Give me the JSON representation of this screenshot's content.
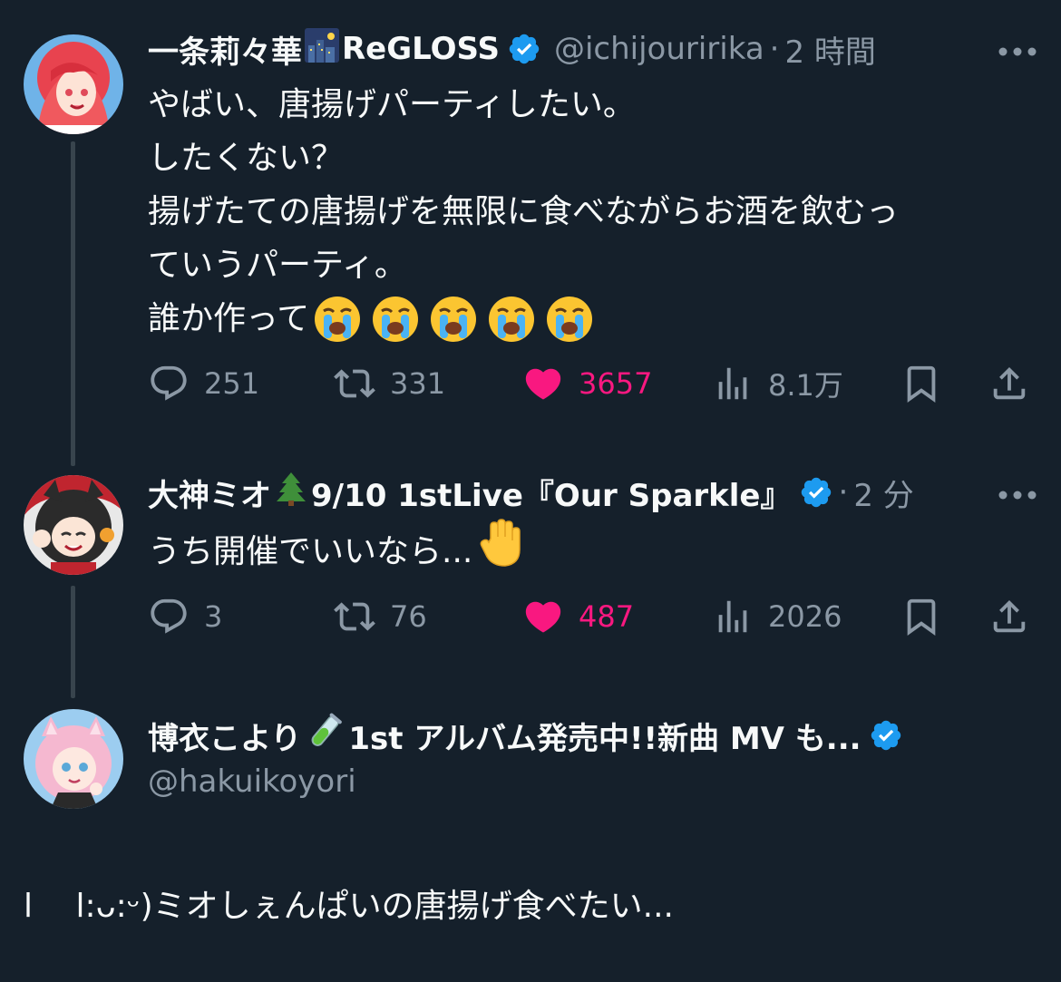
{
  "tweets": [
    {
      "name": "一条莉々華",
      "name_suffix": "ReGLOSS",
      "handle": "@ichijouririka",
      "time": "2 時間",
      "lines": [
        "やばい、唐揚げパーティしたい。",
        "したくない？",
        "揚げたての唐揚げを無限に食べながらお酒を飲むっ",
        "ていうパーティ。",
        "誰か作って"
      ],
      "trailing_emoji": [
        "crying-face",
        "crying-face",
        "crying-face",
        "crying-face",
        "crying-face"
      ],
      "replies": "251",
      "retweets": "331",
      "likes": "3657",
      "views": "8.1万"
    },
    {
      "name": "大神ミオ",
      "name_suffix": "9/10 1stLive『Our Sparkle』",
      "time": "2 分",
      "text": "うち開催でいいなら...",
      "trailing_emoji": [
        "raised-hand"
      ],
      "replies": "3",
      "retweets": "76",
      "likes": "487",
      "views": "2026"
    },
    {
      "name": "博衣こより",
      "name_suffix": "1st アルバム発売中!!新曲 MV も...",
      "handle": "@hakuikoyori",
      "text": "l　 l:ᴗ:ᵕ)ミオしぇんぱいの唐揚げ食べたい..."
    }
  ],
  "colors": {
    "background": "#15202b",
    "text": "#f7f9f9",
    "secondary": "#8b98a5",
    "like": "#f91880",
    "verified": "#1d9bf0",
    "thread_line": "#38444d"
  }
}
